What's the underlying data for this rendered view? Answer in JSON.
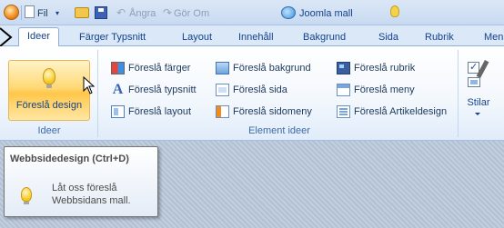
{
  "quick_access": {
    "file_label": "Fil",
    "undo_label": "Ångra",
    "redo_label": "Gör Om",
    "app_title": "Joomla mall"
  },
  "tabs": [
    {
      "label": "Ideer",
      "active": true
    },
    {
      "label": "Färger Typsnitt"
    },
    {
      "label": "Layout"
    },
    {
      "label": "Innehåll"
    },
    {
      "label": "Bakgrund"
    },
    {
      "label": "Sida"
    },
    {
      "label": "Rubrik"
    },
    {
      "label": "Men"
    }
  ],
  "ribbon": {
    "ideer_group": {
      "big_button_label": "Föreslå design",
      "group_label": "Ideer"
    },
    "element_group": {
      "items": [
        {
          "label": "Föreslå färger",
          "icon": "colors-icon"
        },
        {
          "label": "Föreslå typsnitt",
          "icon": "font-icon"
        },
        {
          "label": "Föreslå layout",
          "icon": "layout-icon"
        },
        {
          "label": "Föreslå bakgrund",
          "icon": "background-icon"
        },
        {
          "label": "Föreslå sida",
          "icon": "page-icon"
        },
        {
          "label": "Föreslå sidomeny",
          "icon": "sidemenu-icon"
        },
        {
          "label": "Föreslå rubrik",
          "icon": "headline-icon"
        },
        {
          "label": "Föreslå meny",
          "icon": "menu-icon"
        },
        {
          "label": "Föreslå Artikeldesign",
          "icon": "article-icon"
        }
      ],
      "group_label": "Element ideer"
    },
    "styles_label": "Stilar"
  },
  "tooltip": {
    "title": "Webbsidedesign (Ctrl+D)",
    "description": "Låt oss föreslå Webbsidans mall."
  }
}
